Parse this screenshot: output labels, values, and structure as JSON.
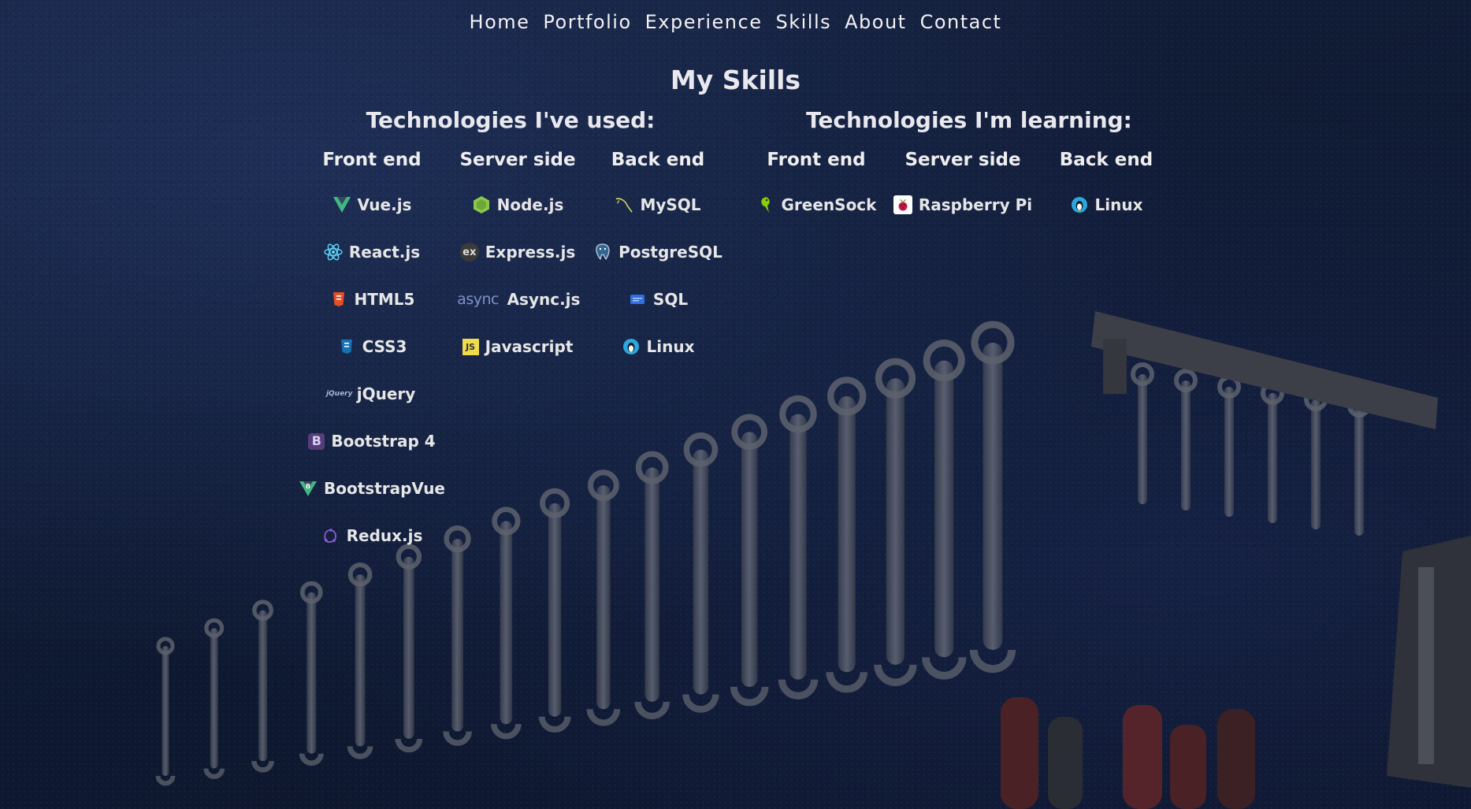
{
  "nav": [
    "Home",
    "Portfolio",
    "Experience",
    "Skills",
    "About",
    "Contact"
  ],
  "title": "My Skills",
  "used": {
    "title": "Technologies I've used:",
    "columns": [
      {
        "heading": "Front end",
        "items": [
          {
            "label": "Vue.js",
            "icon": "vue-icon"
          },
          {
            "label": "React.js",
            "icon": "react-icon"
          },
          {
            "label": "HTML5",
            "icon": "html5-icon"
          },
          {
            "label": "CSS3",
            "icon": "css3-icon"
          },
          {
            "label": "jQuery",
            "icon": "jquery-icon"
          },
          {
            "label": "Bootstrap 4",
            "icon": "bootstrap-icon"
          },
          {
            "label": "BootstrapVue",
            "icon": "bootstrapvue-icon"
          },
          {
            "label": "Redux.js",
            "icon": "redux-icon"
          }
        ]
      },
      {
        "heading": "Server side",
        "items": [
          {
            "label": "Node.js",
            "icon": "nodejs-icon"
          },
          {
            "label": "Express.js",
            "icon": "express-icon"
          },
          {
            "label": "Async.js",
            "icon": "async-icon"
          },
          {
            "label": "Javascript",
            "icon": "javascript-icon"
          }
        ]
      },
      {
        "heading": "Back end",
        "items": [
          {
            "label": "MySQL",
            "icon": "mysql-icon"
          },
          {
            "label": "PostgreSQL",
            "icon": "postgresql-icon"
          },
          {
            "label": "SQL",
            "icon": "sql-icon"
          },
          {
            "label": "Linux",
            "icon": "linux-icon"
          }
        ]
      }
    ]
  },
  "learning": {
    "title": "Technologies I'm learning:",
    "columns": [
      {
        "heading": "Front end",
        "items": [
          {
            "label": "GreenSock",
            "icon": "greensock-icon"
          }
        ]
      },
      {
        "heading": "Server side",
        "items": [
          {
            "label": "Raspberry Pi",
            "icon": "raspberrypi-icon"
          }
        ]
      },
      {
        "heading": "Back end",
        "items": [
          {
            "label": "Linux",
            "icon": "linux-icon"
          }
        ]
      }
    ]
  },
  "icon_text": {
    "express": "ex",
    "async": "async",
    "javascript": "JS",
    "bootstrap": "B",
    "jquery": "jQuery"
  },
  "colors": {
    "vue": "#41b883",
    "react": "#61dafb",
    "html5": "#e34f26",
    "css3": "#1572b6",
    "bootstrap": "#7952b3",
    "node": "#8cc84b",
    "javascript": "#f0db4f",
    "mysql": "#c7d35a",
    "postgres": "#6f93c0",
    "sql": "#2f6fe0",
    "linux": "#29a8e0",
    "greensock": "#88ce02",
    "raspberry": "#c51a4a"
  }
}
